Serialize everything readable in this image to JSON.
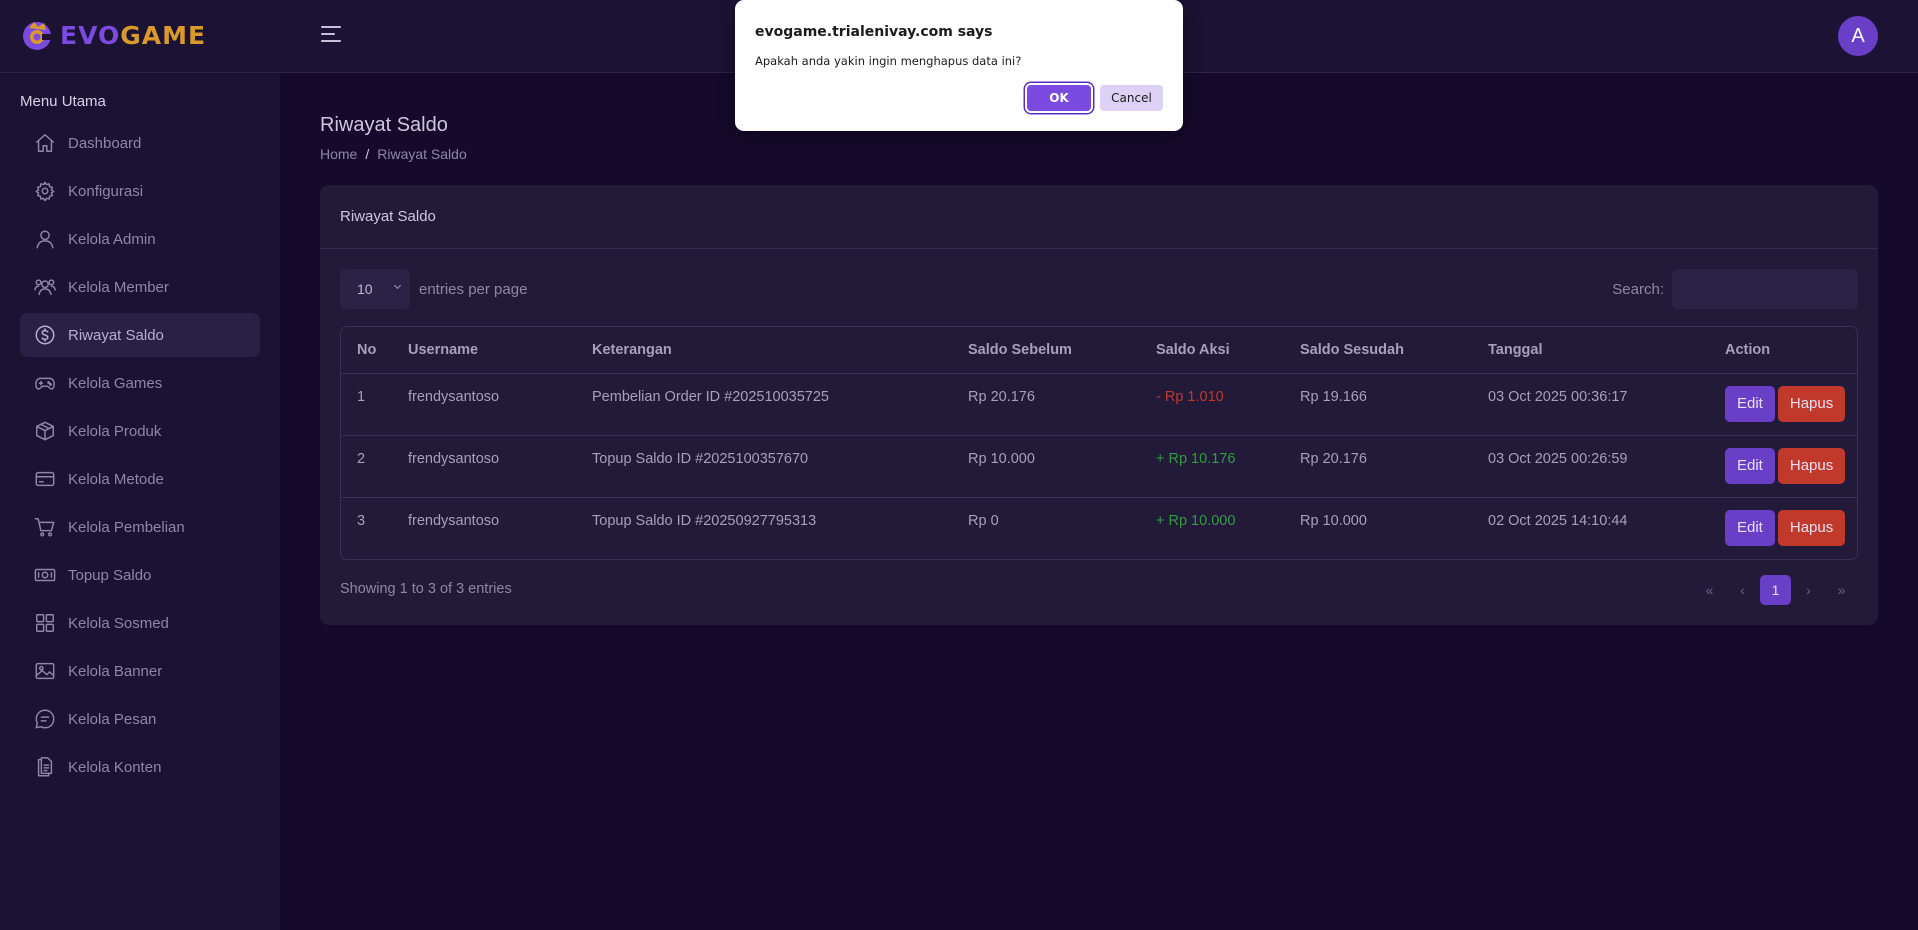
{
  "brand": {
    "name_part1": "EVO",
    "name_part2": "GAME"
  },
  "header": {
    "avatar_initial": "A"
  },
  "sidebar": {
    "title": "Menu Utama",
    "items": [
      {
        "label": "Dashboard",
        "icon": "home-icon"
      },
      {
        "label": "Konfigurasi",
        "icon": "gear-icon"
      },
      {
        "label": "Kelola Admin",
        "icon": "user-icon"
      },
      {
        "label": "Kelola Member",
        "icon": "users-icon"
      },
      {
        "label": "Riwayat Saldo",
        "icon": "dollar-circle-icon",
        "active": true
      },
      {
        "label": "Kelola Games",
        "icon": "gamepad-icon"
      },
      {
        "label": "Kelola Produk",
        "icon": "box-icon"
      },
      {
        "label": "Kelola Metode",
        "icon": "wallet-icon"
      },
      {
        "label": "Kelola Pembelian",
        "icon": "cart-icon"
      },
      {
        "label": "Topup Saldo",
        "icon": "money-icon"
      },
      {
        "label": "Kelola Sosmed",
        "icon": "grid-icon"
      },
      {
        "label": "Kelola Banner",
        "icon": "image-icon"
      },
      {
        "label": "Kelola Pesan",
        "icon": "chat-icon"
      },
      {
        "label": "Kelola Konten",
        "icon": "document-icon"
      }
    ]
  },
  "page": {
    "title": "Riwayat Saldo",
    "breadcrumb": {
      "home": "Home",
      "sep": "/",
      "current": "Riwayat Saldo"
    }
  },
  "card": {
    "title": "Riwayat Saldo",
    "entries_value": "10",
    "entries_label": "entries per page",
    "search_label": "Search:",
    "search_value": ""
  },
  "table": {
    "headers": [
      "No",
      "Username",
      "Keterangan",
      "Saldo Sebelum",
      "Saldo Aksi",
      "Saldo Sesudah",
      "Tanggal",
      "Action"
    ],
    "rows": [
      {
        "no": "1",
        "username": "frendysantoso",
        "keterangan": "Pembelian Order ID #202510035725",
        "sebelum": "Rp 20.176",
        "aksi": "- Rp 1.010",
        "aksi_type": "neg",
        "sesudah": "Rp 19.166",
        "tanggal": "03 Oct 2025 00:36:17"
      },
      {
        "no": "2",
        "username": "frendysantoso",
        "keterangan": "Topup Saldo ID #2025100357670",
        "sebelum": "Rp 10.000",
        "aksi": "+ Rp 10.176",
        "aksi_type": "pos",
        "sesudah": "Rp 20.176",
        "tanggal": "03 Oct 2025 00:26:59"
      },
      {
        "no": "3",
        "username": "frendysantoso",
        "keterangan": "Topup Saldo ID #20250927795313",
        "sebelum": "Rp 0",
        "aksi": "+ Rp 10.000",
        "aksi_type": "pos",
        "sesudah": "Rp 10.000",
        "tanggal": "02 Oct 2025 14:10:44"
      }
    ],
    "edit_label": "Edit",
    "delete_label": "Hapus"
  },
  "footer": {
    "info": "Showing 1 to 3 of 3 entries",
    "pager": {
      "first": "«",
      "prev": "‹",
      "current": "1",
      "next": "›",
      "last": "»"
    }
  },
  "dialog": {
    "title": "evogame.trialenivay.com says",
    "message": "Apakah anda yakin ingin menghapus data ini?",
    "ok_label": "OK",
    "cancel_label": "Cancel"
  },
  "colors": {
    "background": "#150a2b",
    "panel": "#1c1233",
    "card": "#231939",
    "accent": "#6a3fc7",
    "danger": "#c0392b",
    "success": "#2e9e3e",
    "brand_orange": "#d99a2b"
  }
}
